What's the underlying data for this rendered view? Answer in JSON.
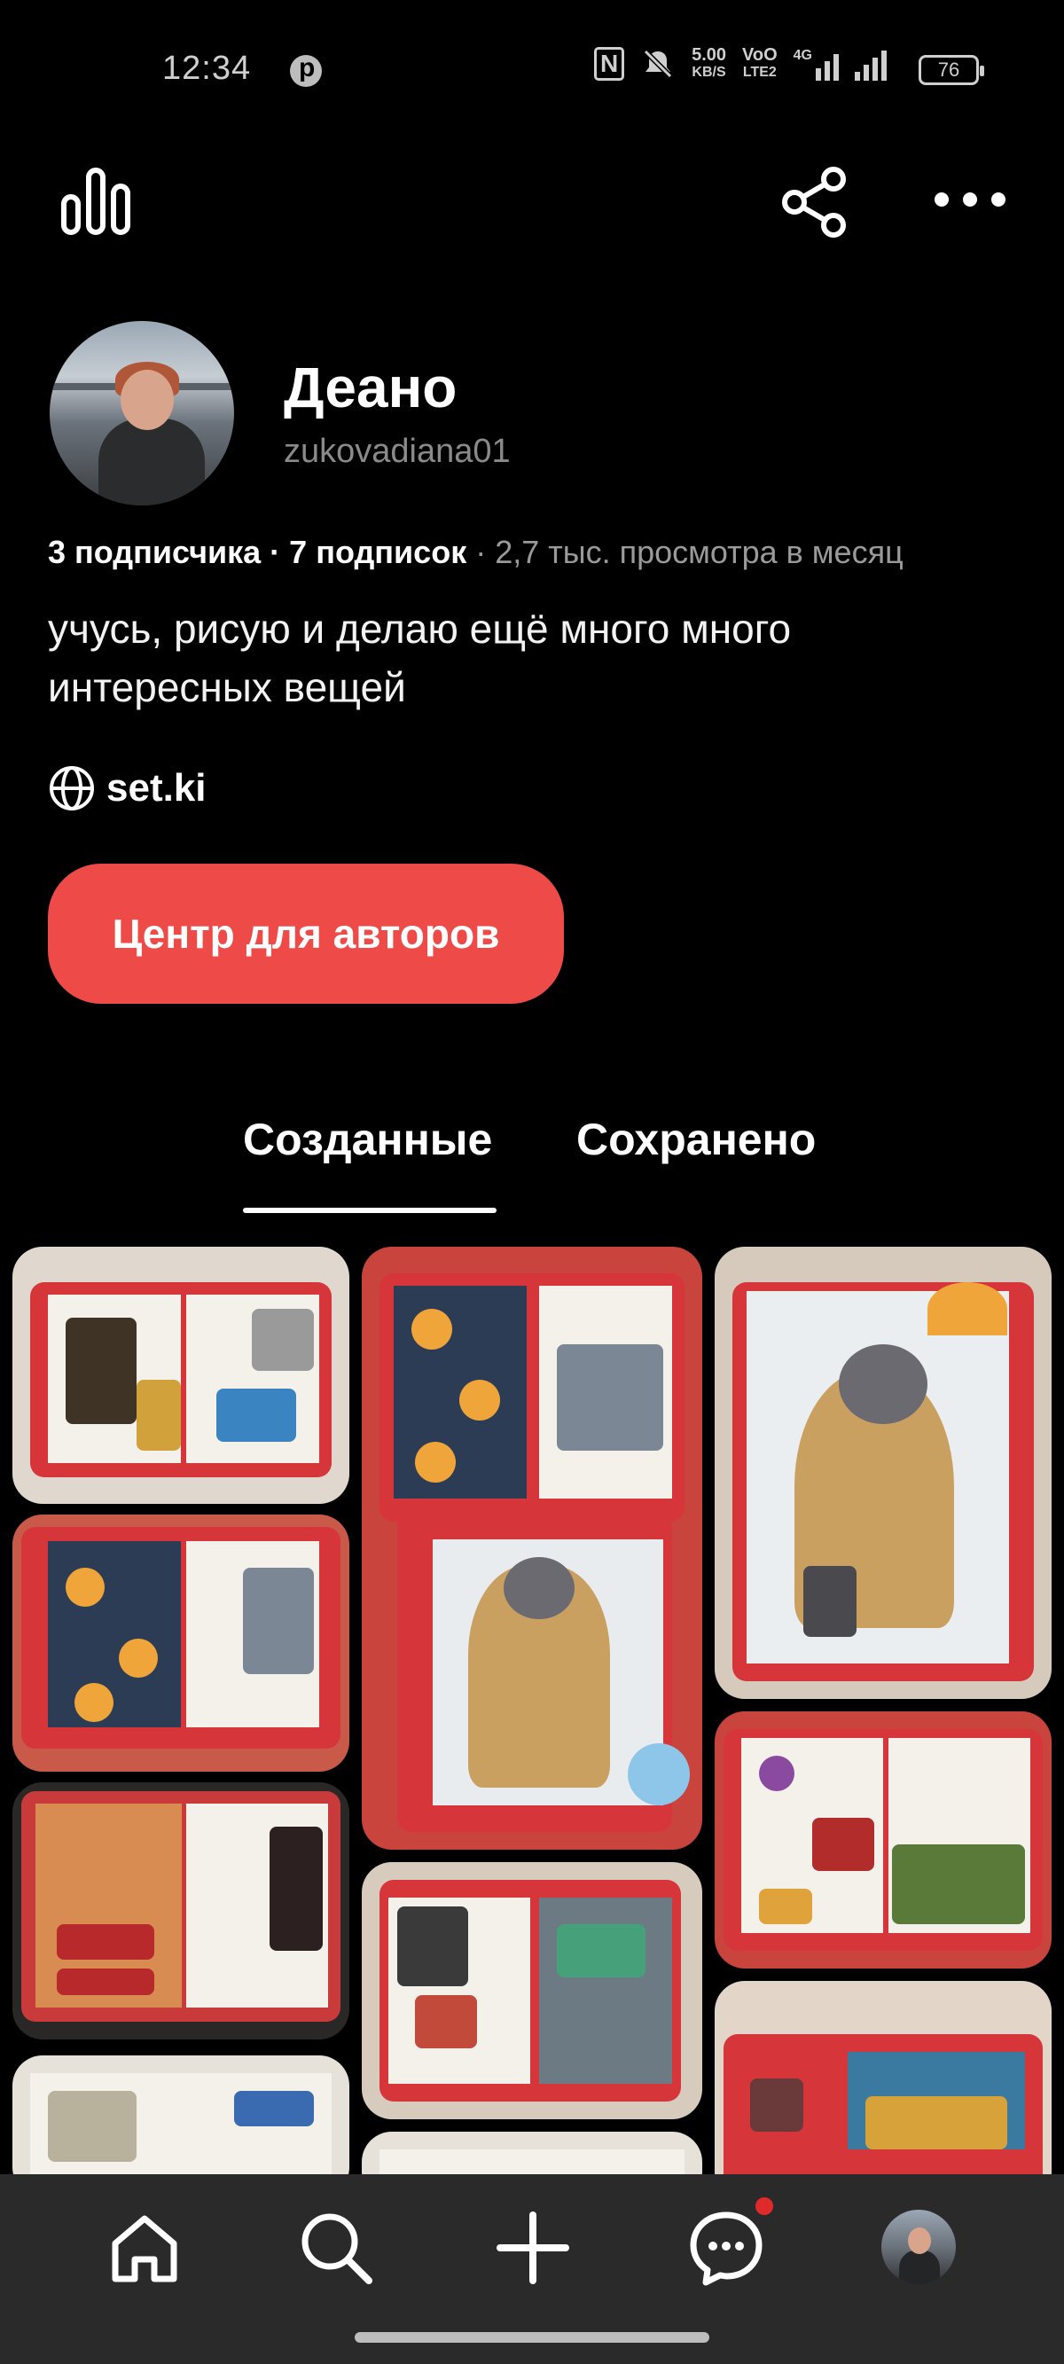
{
  "status_bar": {
    "time": "12:34",
    "network_speed_top": "5.00",
    "network_speed_bottom": "KB/S",
    "volte_top": "VoO",
    "volte_bottom": "LTE2",
    "network_type": "4G",
    "battery": "76"
  },
  "profile": {
    "display_name": "Деано",
    "username": "zukovadiana01",
    "followers": "3 подписчика",
    "separator1": " · ",
    "following": "7 подписок",
    "separator2": " · ",
    "monthly_views": "2,7 тыс. просмотра в месяц",
    "bio": "учусь, рисую и делаю ещё много много интересных вещей",
    "website": "set.ki"
  },
  "actions": {
    "creator_hub_label": "Центр для авторов"
  },
  "tabs": [
    {
      "label": "Созданные",
      "active": true
    },
    {
      "label": "Сохранено",
      "active": false
    }
  ],
  "icons": {
    "top_left": "stats-icon",
    "top_share": "share-icon",
    "top_more": "more-icon",
    "nav": [
      "home-icon",
      "search-icon",
      "add-icon",
      "messages-icon",
      "profile-avatar"
    ]
  },
  "colors": {
    "accent": "#ee4b48",
    "background": "#000000",
    "nav_background": "#2a2a2a",
    "notification": "#e02a2a"
  }
}
